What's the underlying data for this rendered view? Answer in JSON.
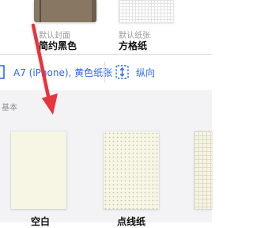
{
  "header": {
    "cover": {
      "caption": "默认封面",
      "name": "简约黑色"
    },
    "paper": {
      "caption": "默认纸张",
      "name": "方格纸"
    }
  },
  "options": {
    "size_label": "A7 (iPhone), 黄色纸张",
    "orientation_label": "纵向"
  },
  "section": {
    "title": "基本",
    "templates": [
      {
        "label": "空白"
      },
      {
        "label": "点线纸"
      },
      {
        "label": ""
      }
    ]
  },
  "colors": {
    "accent": "#2c67f2",
    "arrow": "#e8343c",
    "paper_yellow": "#f7f5e4",
    "cover_brown": "#877763"
  },
  "icons": [
    "page-size-icon",
    "orientation-icon",
    "red-arrow-annotation"
  ]
}
